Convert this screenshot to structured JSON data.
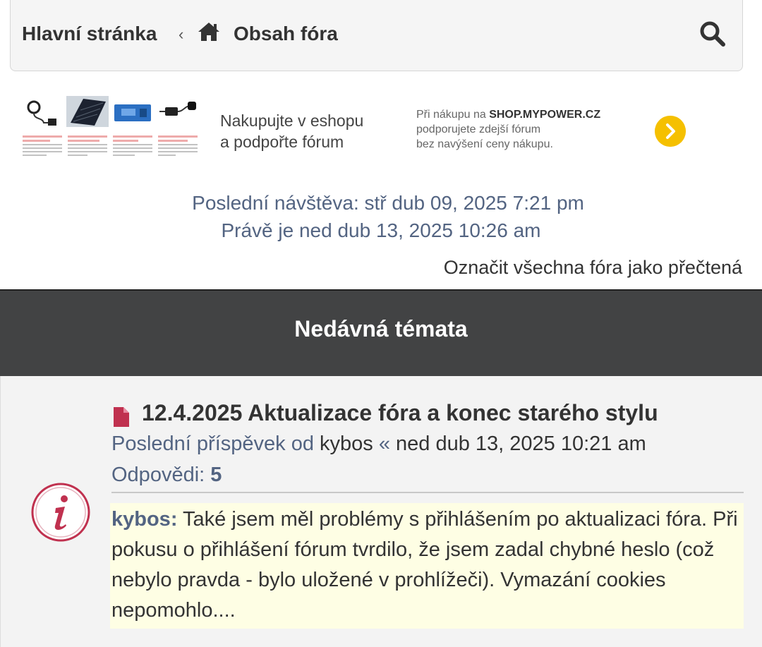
{
  "nav": {
    "home_label": "Hlavní stránka",
    "separator": "‹",
    "forum_label": "Obsah fóra",
    "home_icon": "home-icon",
    "search_icon": "search-icon"
  },
  "banner": {
    "line1": "Nakupujte v eshopu",
    "line2": "a podpořte fórum",
    "side_prefix": "Při nákupu na ",
    "side_shop": "SHOP.MYPOWER.CZ",
    "side_line2": "podporujete zdejší fórum",
    "side_line3": "bez navýšení ceny nákupu.",
    "arrow_icon": "chevron-right-icon",
    "accent": "#f5c000"
  },
  "visit": {
    "last_visit": "Poslední návštěva: stř dub 09, 2025 7:21 pm",
    "now": "Právě je ned dub 13, 2025 10:26 am"
  },
  "mark_read": "Označit všechna fóra jako přečtená",
  "section": {
    "title": "Nedávná témata"
  },
  "topic": {
    "title": "12.4.2025 Aktualizace fóra a konec starého stylu",
    "last_post_label": "Poslední příspěvek od ",
    "author": "kybos",
    "date_sep": " « ",
    "date": "ned dub 13, 2025 10:21 am",
    "replies_label": "Odpovědi: ",
    "replies_count": "5",
    "preview_author": "kybos:",
    "preview_text": " Také jsem měl problémy s přihlášením po aktualizaci fóra. Při pokusu o přihlášení fórum tvrdilo, že jsem zadal chybné heslo (což nebylo pravda - bylo uložené v prohlížeči). Vymazání cookies nepomohlo....",
    "status_icon": "info-icon",
    "type_icon": "file-icon",
    "icon_color": "#c0314f"
  },
  "colors": {
    "link": "#536482",
    "header_bg": "#424344",
    "preview_bg": "#fefee4"
  }
}
